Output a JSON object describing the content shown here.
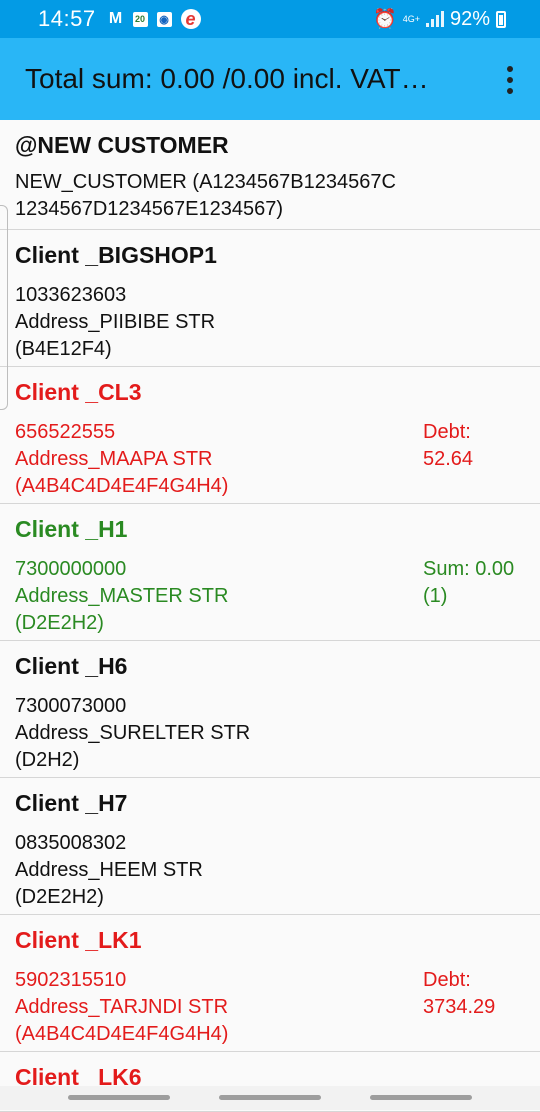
{
  "status_bar": {
    "time": "14:57",
    "battery_percent": "92%",
    "network": "4G+",
    "icons": [
      "gmail-icon",
      "calendar-icon",
      "app-icon",
      "e-app-icon",
      "alarm-icon",
      "signal-icon",
      "battery-icon"
    ]
  },
  "app_bar": {
    "title": "Total sum: 0.00 /0.00 incl. VAT…",
    "menu_icon": "more-vert-icon"
  },
  "colors": {
    "status_bar": "#039be5",
    "app_bar": "#29b6f6",
    "normal": "#111111",
    "debt": "#e31b1b",
    "sum": "#2a8a22"
  },
  "customers": [
    {
      "name": "@NEW CUSTOMER",
      "lines": [
        "NEW_CUSTOMER (A1234567B1234567C",
        "1234567D1234567E1234567)"
      ],
      "side": "",
      "color": "black"
    },
    {
      "name": "Client _BIGSHOP1",
      "lines": [
        "1033623603",
        "Address_PIIBIBE STR",
        "(B4E12F4)"
      ],
      "side": "",
      "color": "black"
    },
    {
      "name": "Client _CL3",
      "lines": [
        "656522555",
        "Address_MAAPA STR",
        "(A4B4C4D4E4F4G4H4)"
      ],
      "side": "Debt:\n52.64",
      "color": "red"
    },
    {
      "name": "Client _H1",
      "lines": [
        "7300000000",
        "Address_MASTER STR",
        "(D2E2H2)"
      ],
      "side": "Sum: 0.00\n(1)",
      "color": "green"
    },
    {
      "name": "Client _H6",
      "lines": [
        "7300073000",
        "Address_SURELTER STR",
        "(D2H2)"
      ],
      "side": "",
      "color": "black"
    },
    {
      "name": "Client _H7",
      "lines": [
        "0835008302",
        "Address_HEEM STR",
        "(D2E2H2)"
      ],
      "side": "",
      "color": "black"
    },
    {
      "name": "Client _LK1",
      "lines": [
        "5902315510",
        "Address_TARJNDI STR",
        "(A4B4C4D4E4F4G4H4)"
      ],
      "side": "Debt:\n3734.29",
      "color": "red"
    },
    {
      "name": "Client _LK6",
      "lines": [],
      "side": "",
      "color": "red"
    }
  ]
}
